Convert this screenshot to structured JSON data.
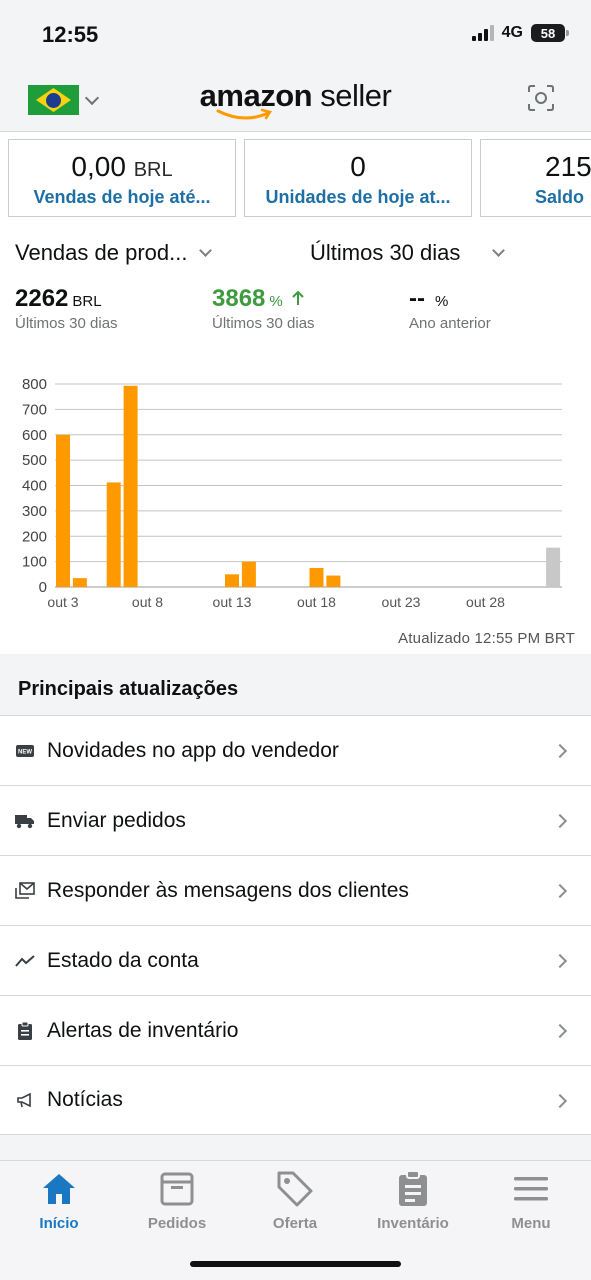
{
  "status_bar": {
    "time": "12:55",
    "network": "4G",
    "battery": "58"
  },
  "header": {
    "brand_main": "amazon",
    "brand_sub": "seller"
  },
  "cards": [
    {
      "value": "0,00",
      "unit": "BRL",
      "label": "Vendas de hoje até..."
    },
    {
      "value": "0",
      "unit": "",
      "label": "Unidades de hoje at..."
    },
    {
      "value": "215",
      "unit": "",
      "label": "Saldo"
    }
  ],
  "selectors": {
    "metric": "Vendas de prod...",
    "period": "Últimos 30 dias"
  },
  "stats": [
    {
      "value": "2262",
      "unit": "BRL",
      "sub": "Últimos 30 dias"
    },
    {
      "value": "3868",
      "unit": "%",
      "sub": "Últimos 30 dias",
      "trend": "up"
    },
    {
      "value": "--",
      "unit": "%",
      "sub": "Ano anterior"
    }
  ],
  "chart_data": {
    "type": "bar",
    "x_tick_labels": [
      "out 3",
      "out 8",
      "out 13",
      "out 18",
      "out 23",
      "out 28"
    ],
    "y_ticks": [
      0,
      100,
      200,
      300,
      400,
      500,
      600,
      700,
      800
    ],
    "ylim": [
      0,
      800
    ],
    "grid": true,
    "bar_colors": {
      "past": "#ff9900",
      "today": "#c8c8c8"
    },
    "bars": [
      {
        "day": 3,
        "value": 600
      },
      {
        "day": 4,
        "value": 35
      },
      {
        "day": 6,
        "value": 412
      },
      {
        "day": 7,
        "value": 793
      },
      {
        "day": 13,
        "value": 50
      },
      {
        "day": 14,
        "value": 100
      },
      {
        "day": 18,
        "value": 75
      },
      {
        "day": 19,
        "value": 45
      },
      {
        "day": 32,
        "value": 155,
        "today": true
      }
    ]
  },
  "updated_text": "Atualizado 12:55 PM BRT",
  "updates": {
    "title": "Principais atualizações",
    "items": [
      {
        "label": "Novidades no app do vendedor",
        "icon": "new-badge-icon"
      },
      {
        "label": "Enviar pedidos",
        "icon": "truck-icon"
      },
      {
        "label": "Responder às mensagens dos clientes",
        "icon": "messages-icon"
      },
      {
        "label": "Estado da conta",
        "icon": "trend-line-icon"
      },
      {
        "label": "Alertas de inventário",
        "icon": "clipboard-icon"
      },
      {
        "label": "Notícias",
        "icon": "megaphone-icon"
      }
    ]
  },
  "tabs": [
    {
      "label": "Início",
      "icon": "home-icon",
      "active": true
    },
    {
      "label": "Pedidos",
      "icon": "box-icon",
      "active": false
    },
    {
      "label": "Oferta",
      "icon": "tag-icon",
      "active": false
    },
    {
      "label": "Inventário",
      "icon": "clipboard-icon",
      "active": false
    },
    {
      "label": "Menu",
      "icon": "hamburger-menu-icon",
      "active": false
    }
  ],
  "colors": {
    "accent": "#1a78c2",
    "link": "#1d6fa5",
    "positive": "#3d9a3f",
    "bar": "#ff9900"
  }
}
